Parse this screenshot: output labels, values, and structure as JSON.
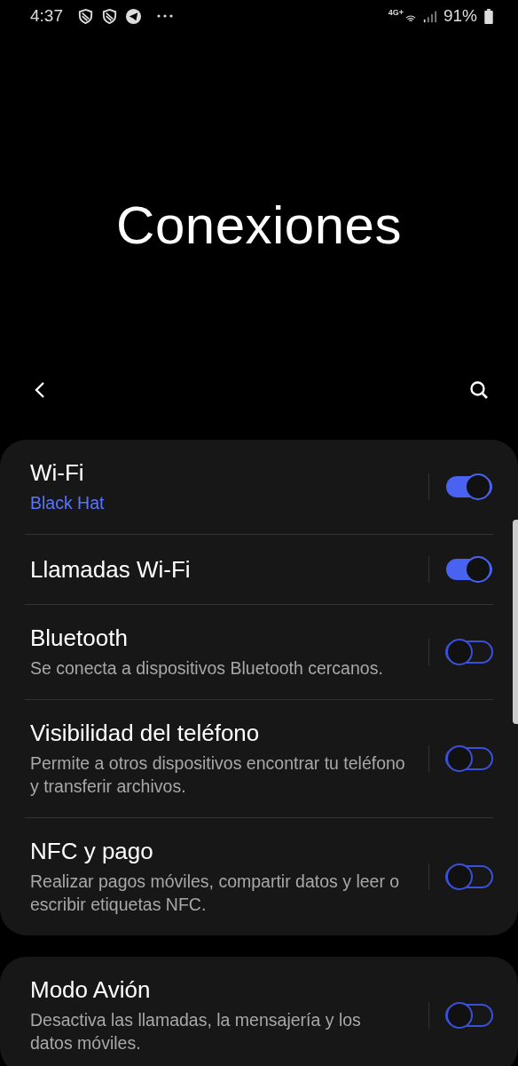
{
  "status_bar": {
    "time": "4:37",
    "network": "4G+",
    "battery": "91%"
  },
  "title": "Conexiones",
  "groups": [
    {
      "items": [
        {
          "kind": "status",
          "label": "Wi-Fi",
          "subtitle": "Black Hat",
          "on": true
        },
        {
          "kind": "plain",
          "label": "Llamadas Wi-Fi",
          "on": true
        },
        {
          "kind": "description",
          "label": "Bluetooth",
          "subtitle": "Se conecta a dispositivos Bluetooth cercanos.",
          "on": false
        },
        {
          "kind": "description",
          "label": "Visibilidad del teléfono",
          "subtitle": "Permite a otros dispositivos encontrar tu teléfono y transferir archivos.",
          "on": false
        },
        {
          "kind": "description",
          "label": "NFC y pago",
          "subtitle": "Realizar pagos móviles, compartir datos y leer o escribir etiquetas NFC.",
          "on": false
        }
      ]
    },
    {
      "items": [
        {
          "kind": "description",
          "label": "Modo Avión",
          "subtitle": "Desactiva las llamadas, la mensajería y los datos móviles.",
          "on": false
        }
      ]
    }
  ]
}
